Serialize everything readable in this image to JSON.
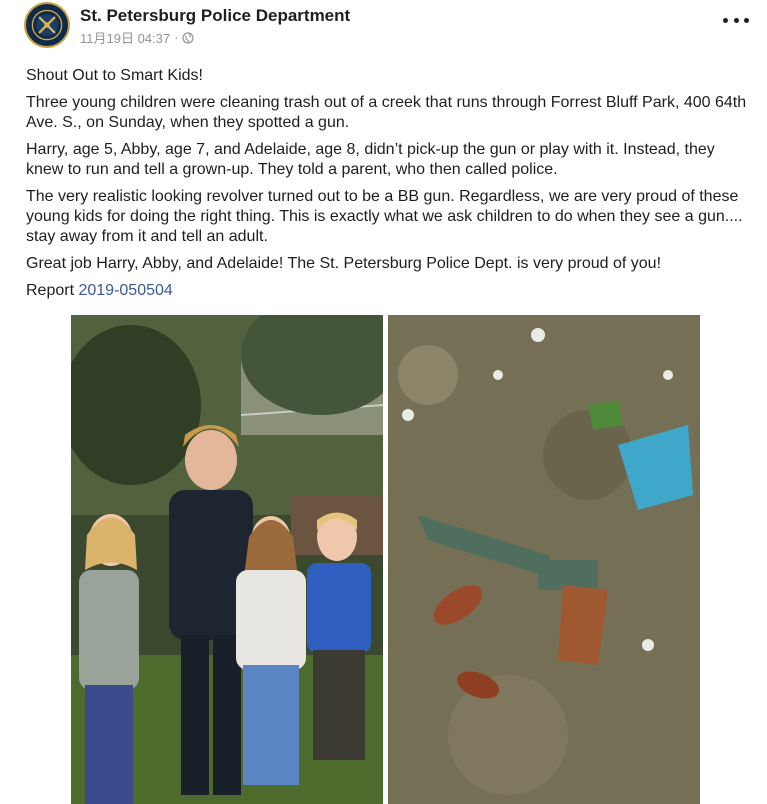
{
  "post": {
    "author": "St. Petersburg Police Department",
    "timestamp": "11月19日 04:37",
    "separator": "·",
    "privacy_icon": "globe-icon",
    "more_icon": "more-options-icon"
  },
  "body": {
    "p1": "Shout Out to Smart Kids!",
    "p2": "Three young children were cleaning trash out of a creek that runs through Forrest Bluff Park, 400 64th Ave. S., on Sunday, when they spotted a gun.",
    "p3": "Harry, age 5, Abby, age 7, and Adelaide, age 8, didn’t pick-up the gun or play with it. Instead, they knew to run and tell a grown-up. They told a parent, who then called police.",
    "p4": "The very realistic looking revolver turned out to be a BB gun. Regardless, we are very proud of these young kids for doing the right thing. This is exactly what we ask children to do when they see a gun.... stay away from it and tell an adult.",
    "p5": "Great job Harry, Abby, and Adelaide! The St. Petersburg Police Dept. is very proud of you!",
    "report_label": "Report",
    "report_number": "2019-050504"
  },
  "colors": {
    "link": "#385898",
    "meta": "#90949c",
    "text": "#1c1e21"
  }
}
